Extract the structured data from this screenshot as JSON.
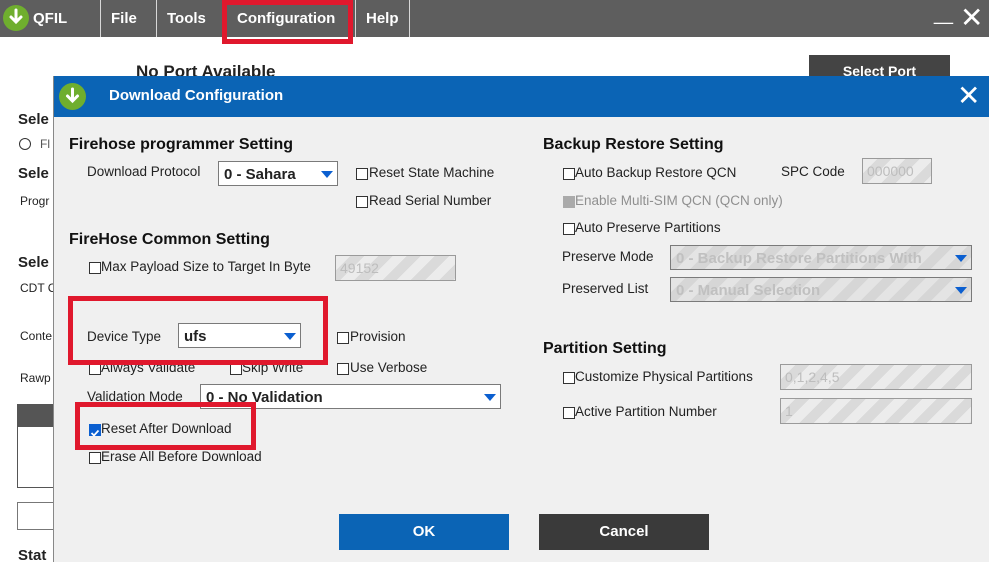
{
  "app": {
    "name": "QFIL",
    "menu": [
      "File",
      "Tools",
      "Configuration",
      "Help"
    ],
    "min_symbol": "_",
    "close_symbol": "✕"
  },
  "background": {
    "port_status": "No Port Available",
    "select_port": "Select Port",
    "frag_select_1": "Sele",
    "frag_radio": "Fl",
    "frag_select_2": "Sele",
    "frag_prog": "Progr",
    "frag_select_3": "Sele",
    "frag_cdt": "CDT C",
    "frag_conte": "Conte",
    "frag_rawp": "Rawp",
    "frag_stat": "Stat"
  },
  "dialog": {
    "title": "Download Configuration",
    "close_symbol": "✕",
    "firehose_programmer": {
      "heading": "Firehose programmer Setting",
      "protocol_label": "Download Protocol",
      "protocol_value": "0 - Sahara",
      "reset_state_machine": "Reset State Machine",
      "read_serial_number": "Read Serial Number"
    },
    "firehose_common": {
      "heading": "FireHose Common Setting",
      "max_payload_label": "Max Payload Size to Target In Byte",
      "max_payload_value": "49152",
      "device_type_label": "Device Type",
      "device_type_value": "ufs",
      "provision": "Provision",
      "always_validate": "Always Validate",
      "skip_write": "Skip Write",
      "use_verbose": "Use Verbose",
      "validation_mode_label": "Validation Mode",
      "validation_mode_value": "0 - No Validation",
      "reset_after_download": "Reset After Download",
      "erase_all_before_download": "Erase All Before Download"
    },
    "backup_restore": {
      "heading": "Backup Restore Setting",
      "auto_backup_restore_qcn": "Auto Backup Restore QCN",
      "spc_code_label": "SPC Code",
      "spc_code_value": "000000",
      "enable_multi_sim": "Enable Multi-SIM QCN (QCN only)",
      "auto_preserve_partitions": "Auto Preserve Partitions",
      "preserve_mode_label": "Preserve Mode",
      "preserve_mode_value": "0 - Backup Restore Partitions With",
      "preserved_list_label": "Preserved List",
      "preserved_list_value": "0 - Manual Selection"
    },
    "partition": {
      "heading": "Partition Setting",
      "customize_physical": "Customize Physical Partitions",
      "customize_physical_value": "0,1,2,4,5",
      "active_partition": "Active Partition Number",
      "active_partition_value": "1"
    },
    "ok": "OK",
    "cancel": "Cancel"
  },
  "colors": {
    "appbar": "#5e5e5e",
    "dialog_title": "#0b64b5",
    "highlight": "#e0182d",
    "ok_button": "#0b64b5",
    "cancel_button": "#3a3a3a"
  }
}
